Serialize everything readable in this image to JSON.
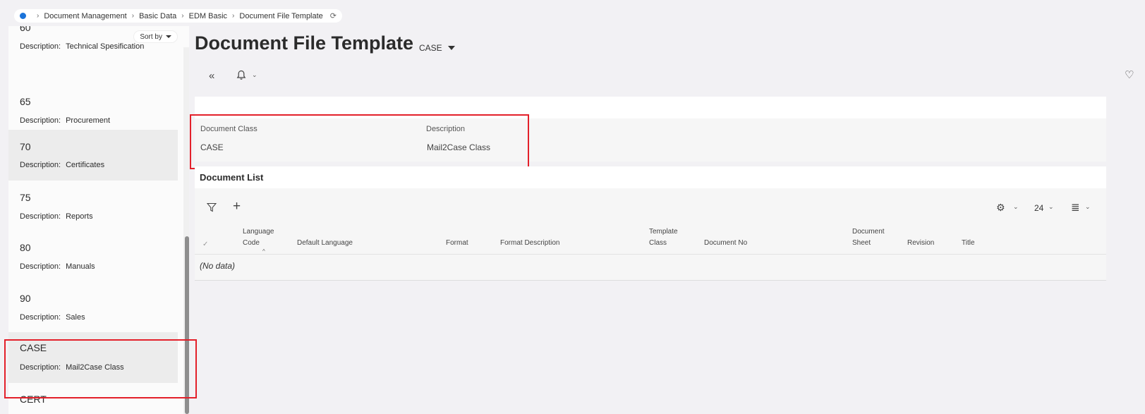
{
  "breadcrumb": {
    "items": [
      "Document Management",
      "Basic Data",
      "EDM Basic",
      "Document File Template"
    ]
  },
  "sidebar": {
    "sort_label": "Sort by",
    "desc_label": "Description:",
    "items": [
      {
        "code": "60",
        "description": "Technical Spesification"
      },
      {
        "code": "65",
        "description": "Procurement"
      },
      {
        "code": "70",
        "description": "Certificates"
      },
      {
        "code": "75",
        "description": "Reports"
      },
      {
        "code": "80",
        "description": "Manuals"
      },
      {
        "code": "90",
        "description": "Sales"
      },
      {
        "code": "CASE",
        "description": "Mail2Case Class"
      },
      {
        "code": "CERT",
        "description": ""
      }
    ]
  },
  "header": {
    "title": "Document File Template",
    "context": "CASE"
  },
  "detail": {
    "document_class_label": "Document Class",
    "document_class_value": "CASE",
    "description_label": "Description",
    "description_value": "Mail2Case Class"
  },
  "document_list": {
    "title": "Document List",
    "page_size": "24",
    "columns": {
      "language_code_1": "Language",
      "language_code_2": "Code",
      "default_language": "Default Language",
      "format": "Format",
      "format_description": "Format Description",
      "template_class_1": "Template",
      "template_class_2": "Class",
      "document_no": "Document No",
      "document_sheet_1": "Document",
      "document_sheet_2": "Sheet",
      "revision": "Revision",
      "title": "Title"
    },
    "empty_text": "(No data)"
  },
  "colors": {
    "accent": "#1a73d9",
    "highlight": "#e3202a"
  }
}
